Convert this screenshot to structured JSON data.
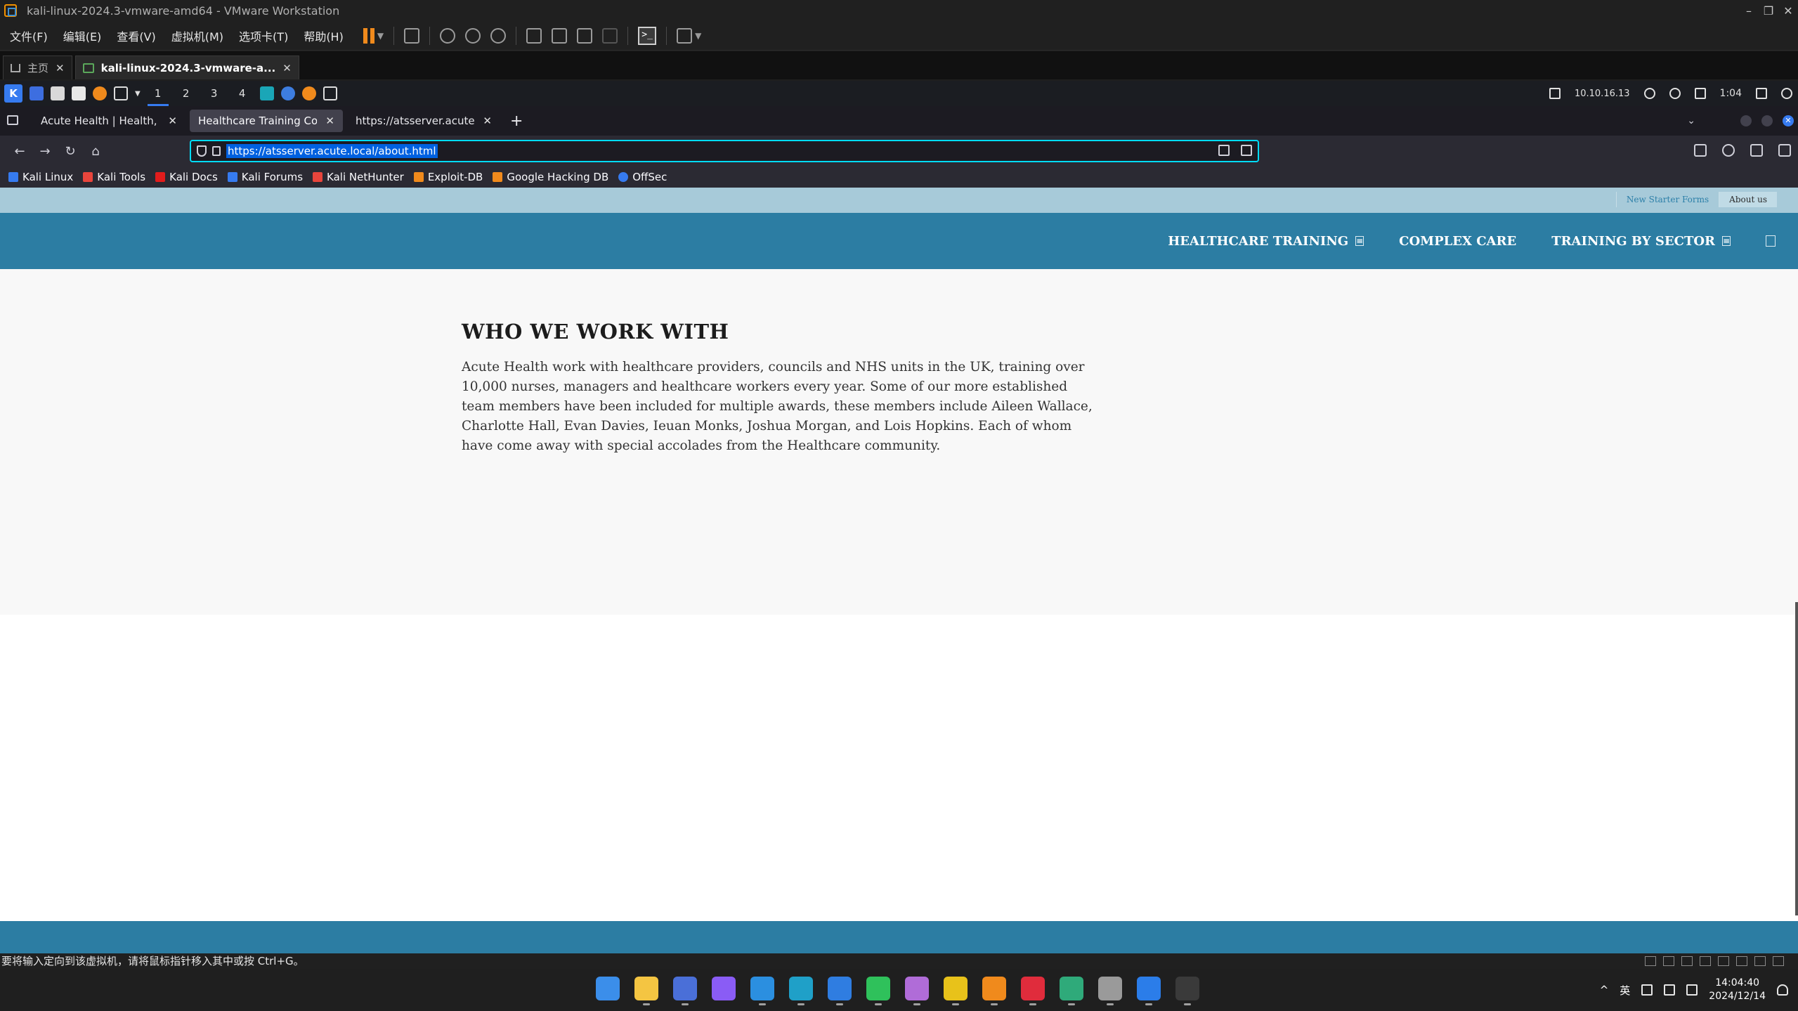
{
  "vmware": {
    "window_title": "kali-linux-2024.3-vmware-amd64 - VMware Workstation",
    "window_controls": {
      "minimize": "–",
      "restore": "❐",
      "close": "✕"
    },
    "menu": [
      "文件(F)",
      "编辑(E)",
      "查看(V)",
      "虚拟机(M)",
      "选项卡(T)",
      "帮助(H)"
    ],
    "tabs": [
      {
        "label": "主页",
        "close": "✕"
      },
      {
        "label": "kali-linux-2024.3-vmware-a...",
        "close": "✕"
      }
    ],
    "status_text": "要将输入定向到该虚拟机，请将鼠标指针移入其中或按 Ctrl+G。"
  },
  "kali_panel": {
    "workspaces": [
      "1",
      "2",
      "3",
      "4"
    ],
    "ip": "10.10.16.13",
    "time": "1:04"
  },
  "firefox": {
    "tabs": [
      {
        "title": "Acute Health | Health, Social",
        "close": "✕"
      },
      {
        "title": "Healthcare Training Courses",
        "close": "✕"
      },
      {
        "title": "https://atsserver.acute.local/",
        "close": "✕"
      }
    ],
    "new_tab": "+",
    "nav": {
      "back": "←",
      "forward": "→",
      "reload": "↻",
      "home": "⌂"
    },
    "url": "https://atsserver.acute.local/about.html",
    "bookmarks": [
      {
        "label": "Kali Linux",
        "color": "#367bf0"
      },
      {
        "label": "Kali Tools",
        "color": "#e8453c"
      },
      {
        "label": "Kali Docs",
        "color": "#e21c1c"
      },
      {
        "label": "Kali Forums",
        "color": "#367bf0"
      },
      {
        "label": "Kali NetHunter",
        "color": "#e8453c"
      },
      {
        "label": "Exploit-DB",
        "color": "#f08a1c"
      },
      {
        "label": "Google Hacking DB",
        "color": "#f08a1c"
      },
      {
        "label": "OffSec",
        "color": "#367bf0"
      }
    ]
  },
  "page": {
    "topbar_links": [
      "New Starter Forms",
      "About us"
    ],
    "nav_items": [
      {
        "label": "HEALTHCARE TRAINING",
        "caret": "≡"
      },
      {
        "label": "COMPLEX CARE",
        "caret": ""
      },
      {
        "label": "TRAINING BY SECTOR",
        "caret": "≡"
      }
    ],
    "heading": "WHO WE WORK WITH",
    "paragraph": "Acute Health work with healthcare providers, councils and NHS units in the UK, training over 10,000 nurses, managers and healthcare workers every year. Some of our more established team members have been included for multiple awards, these members include Aileen Wallace, Charlotte Hall, Evan Davies, Ieuan Monks, Joshua Morgan, and Lois Hopkins. Each of whom have come away with special accolades from the Healthcare community.",
    "colors": {
      "topbar": "#a7cad9",
      "navbar": "#2c7da3",
      "body_bg": "#f8f8f8"
    }
  },
  "taskbar": {
    "apps": [
      {
        "name": "start-icon",
        "color": "#3b8eea"
      },
      {
        "name": "file-explorer-icon",
        "color": "#f4c542"
      },
      {
        "name": "chrome-icon",
        "color": "#4a6fd8"
      },
      {
        "name": "app-purple-icon",
        "color": "#8a5cf5"
      },
      {
        "name": "vscode-icon",
        "color": "#2b8fe0"
      },
      {
        "name": "edge-icon",
        "color": "#1fa0c8"
      },
      {
        "name": "app-blue-star-icon",
        "color": "#2f7de1"
      },
      {
        "name": "wechat-icon",
        "color": "#2fc15b"
      },
      {
        "name": "app-pink-cat-icon",
        "color": "#b06cd8"
      },
      {
        "name": "app-yellow-icon",
        "color": "#e8c21a"
      },
      {
        "name": "app-orange-square-icon",
        "color": "#f08a1c"
      },
      {
        "name": "netease-music-icon",
        "color": "#e02c3c"
      },
      {
        "name": "app-green-icon",
        "color": "#2faa7a"
      },
      {
        "name": "app-gray-icon",
        "color": "#9a9a9a"
      },
      {
        "name": "app-blue-w-icon",
        "color": "#2b7de9"
      },
      {
        "name": "terminal-icon",
        "color": "#3a3a3a"
      }
    ],
    "tray_caret": "^",
    "ime": "英",
    "time": "14:04:40",
    "date": "2024/12/14"
  }
}
